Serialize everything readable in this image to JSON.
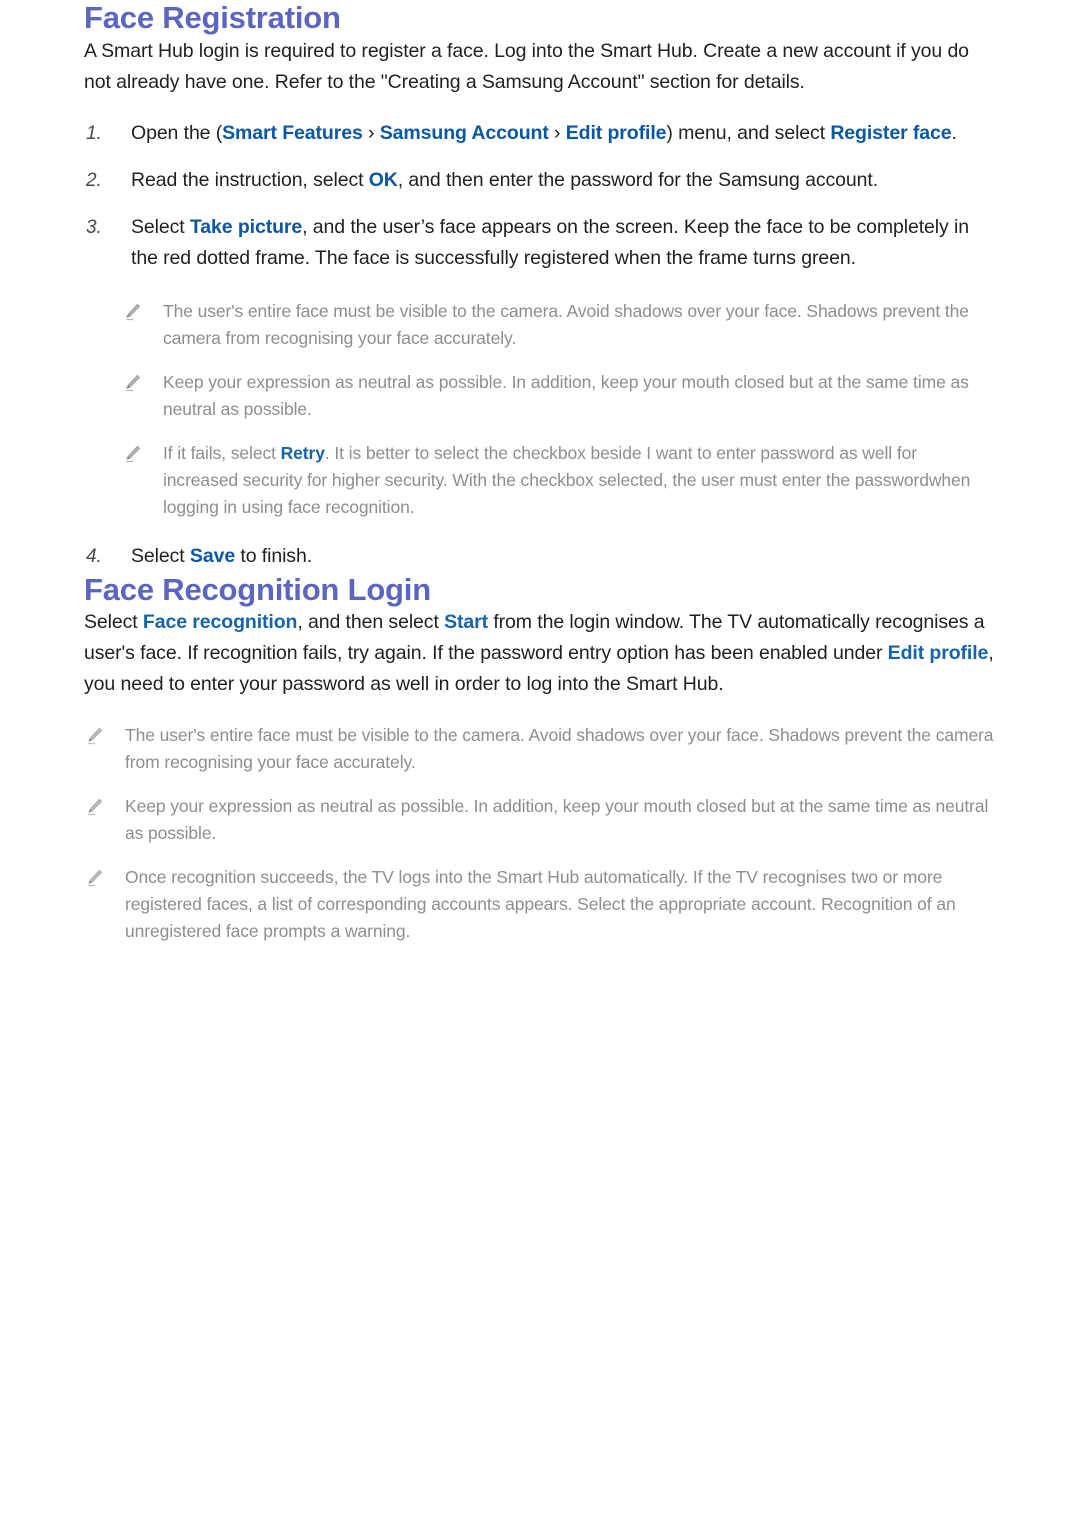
{
  "colors": {
    "heading": "#5b66c2",
    "keyword": "#0b57a4",
    "keyword_light": "#1464ac",
    "body_text": "#231f20",
    "note_text": "#8e8e91",
    "background": "#ffffff"
  },
  "sections": [
    {
      "id": "face-registration",
      "title": "Face Registration",
      "intro": {
        "line1": "A Smart Hub login is required to register a face. Log into the Smart Hub. Create a new account if you",
        "line2": "do not already have one. Refer to the \"Creating a Samsung Account\" section for details."
      },
      "steps": [
        {
          "num": "1.",
          "pre": "Open the (",
          "kw1": "Smart Features",
          "sep1": " › ",
          "kw2": "Samsung Account",
          "sep2": " › ",
          "kw3": "Edit profile",
          "mid": ") menu, and select ",
          "kw4": "Register face",
          "post": "."
        },
        {
          "num": "2.",
          "pre": "Read the instruction, select ",
          "kw1": "OK",
          "post": ", and then enter the password for the Samsung account."
        },
        {
          "num": "3.",
          "pre": "Select ",
          "kw1": "Take picture",
          "post": ", and the user’s face appears on the screen. Keep the face to be completely in the red dotted frame. The face is successfully registered when the frame turns green."
        },
        {
          "num": "4.",
          "pre": "Select ",
          "kw1": "Save",
          "post": " to finish."
        }
      ],
      "notes": [
        {
          "icon": "pencil-icon",
          "pre": "The user's entire face must be visible to the camera. Avoid shadows over your face. Shadows prevent the camera from recognising your face accurately.",
          "kw": "",
          "post": ""
        },
        {
          "icon": "pencil-icon",
          "pre": "Keep your expression as neutral as possible. In addition, keep your mouth closed but at the same time as neutral as possible.",
          "kw": "",
          "post": ""
        },
        {
          "icon": "pencil-icon",
          "pre": "If it fails, select ",
          "kw": "Retry",
          "post": ". It is better to select the checkbox beside I want to enter password as well for increased security for higher security. With the checkbox selected, the user must enter the passwordwhen logging in using face recognition."
        }
      ]
    },
    {
      "id": "face-recognition-login",
      "title": "Face Recognition Login",
      "paragraph": {
        "pre": "Select ",
        "kw1": "Face recognition",
        "mid1": ", and then select ",
        "kw2": "Start",
        "mid2": " from the login window. The TV automatically recognises a user's face. If recognition fails, try again. If the password entry option has been enabled under ",
        "kw3": "Edit profile",
        "post": ", you need to enter your password as well in order to log into the Smart Hub."
      },
      "notes": [
        {
          "icon": "pencil-icon",
          "text": "The user's entire face must be visible to the camera. Avoid shadows over your face. Shadows prevent the camera from recognising your face accurately."
        },
        {
          "icon": "pencil-icon",
          "text": "Keep your expression as neutral as possible. In addition, keep your mouth closed but at the same time as neutral as possible."
        },
        {
          "icon": "pencil-icon",
          "text": "Once recognition succeeds, the TV logs into the Smart Hub automatically. If the TV recognises two or more registered faces, a list of corresponding accounts appears. Select the appropriate account. Recognition of an unregistered face prompts a warning."
        }
      ]
    }
  ]
}
